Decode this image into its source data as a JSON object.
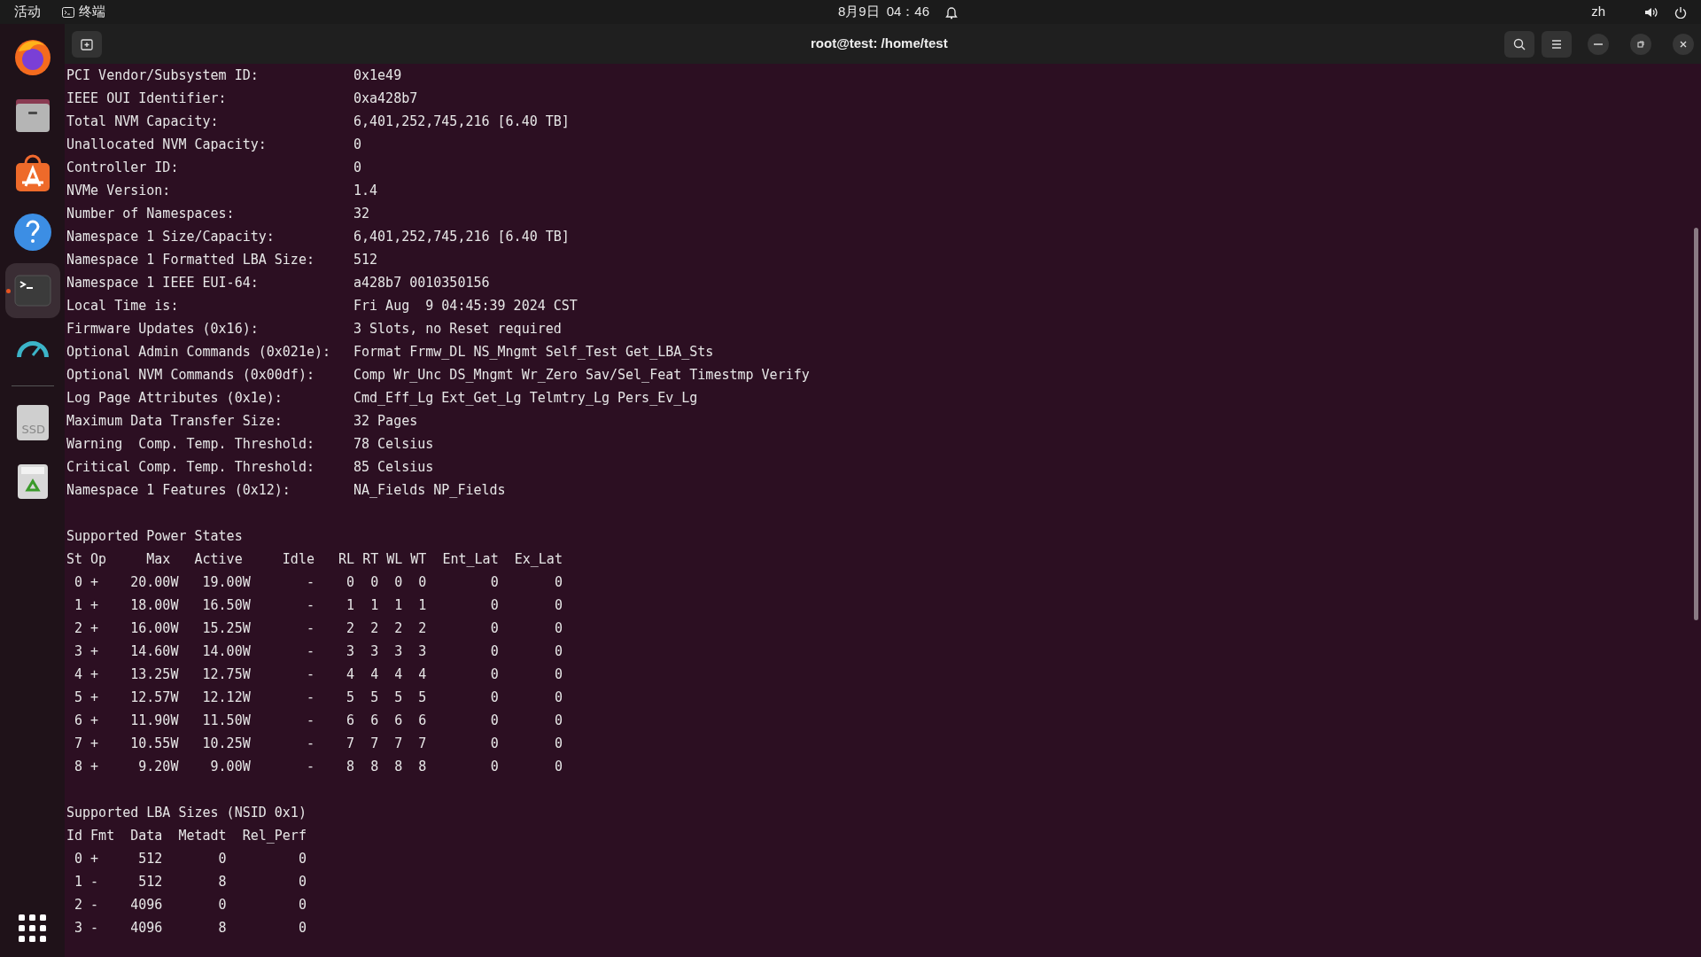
{
  "top_bar": {
    "activities": "活动",
    "app_name": "终端",
    "date": "8月9日",
    "time": "04：46",
    "language": "zh"
  },
  "dock": {
    "items": [
      {
        "kind": "firefox",
        "active": false
      },
      {
        "kind": "files",
        "active": false
      },
      {
        "kind": "store",
        "active": false
      },
      {
        "kind": "help",
        "active": false
      },
      {
        "kind": "terminal",
        "active": true
      },
      {
        "kind": "gauge",
        "active": false
      },
      {
        "kind": "separator"
      },
      {
        "kind": "ssd",
        "active": false,
        "label": "SSD"
      },
      {
        "kind": "trash",
        "active": false
      }
    ]
  },
  "window": {
    "title": "root@test: /home/test"
  },
  "terminal": {
    "fields": [
      {
        "label": "PCI Vendor/Subsystem ID:",
        "value": "0x1e49"
      },
      {
        "label": "IEEE OUI Identifier:",
        "value": "0xa428b7"
      },
      {
        "label": "Total NVM Capacity:",
        "value": "6,401,252,745,216 [6.40 TB]"
      },
      {
        "label": "Unallocated NVM Capacity:",
        "value": "0"
      },
      {
        "label": "Controller ID:",
        "value": "0"
      },
      {
        "label": "NVMe Version:",
        "value": "1.4"
      },
      {
        "label": "Number of Namespaces:",
        "value": "32"
      },
      {
        "label": "Namespace 1 Size/Capacity:",
        "value": "6,401,252,745,216 [6.40 TB]"
      },
      {
        "label": "Namespace 1 Formatted LBA Size:",
        "value": "512"
      },
      {
        "label": "Namespace 1 IEEE EUI-64:",
        "value": "a428b7 0010350156"
      },
      {
        "label": "Local Time is:",
        "value": "Fri Aug  9 04:45:39 2024 CST"
      },
      {
        "label": "Firmware Updates (0x16):",
        "value": "3 Slots, no Reset required"
      },
      {
        "label": "Optional Admin Commands (0x021e):",
        "value": "Format Frmw_DL NS_Mngmt Self_Test Get_LBA_Sts"
      },
      {
        "label": "Optional NVM Commands (0x00df):",
        "value": "Comp Wr_Unc DS_Mngmt Wr_Zero Sav/Sel_Feat Timestmp Verify"
      },
      {
        "label": "Log Page Attributes (0x1e):",
        "value": "Cmd_Eff_Lg Ext_Get_Lg Telmtry_Lg Pers_Ev_Lg"
      },
      {
        "label": "Maximum Data Transfer Size:",
        "value": "32 Pages"
      },
      {
        "label": "Warning  Comp. Temp. Threshold:",
        "value": "78 Celsius"
      },
      {
        "label": "Critical Comp. Temp. Threshold:",
        "value": "85 Celsius"
      },
      {
        "label": "Namespace 1 Features (0x12):",
        "value": "NA_Fields NP_Fields"
      }
    ],
    "tables": [
      {
        "title": "Supported Power States",
        "header": "St Op     Max   Active     Idle   RL RT WL WT  Ent_Lat  Ex_Lat",
        "rows": [
          " 0 +    20.00W   19.00W       -    0  0  0  0        0       0",
          " 1 +    18.00W   16.50W       -    1  1  1  1        0       0",
          " 2 +    16.00W   15.25W       -    2  2  2  2        0       0",
          " 3 +    14.60W   14.00W       -    3  3  3  3        0       0",
          " 4 +    13.25W   12.75W       -    4  4  4  4        0       0",
          " 5 +    12.57W   12.12W       -    5  5  5  5        0       0",
          " 6 +    11.90W   11.50W       -    6  6  6  6        0       0",
          " 7 +    10.55W   10.25W       -    7  7  7  7        0       0",
          " 8 +     9.20W    9.00W       -    8  8  8  8        0       0"
        ]
      },
      {
        "title": "Supported LBA Sizes (NSID 0x1)",
        "header": "Id Fmt  Data  Metadt  Rel_Perf",
        "rows": [
          " 0 +     512       0         0",
          " 1 -     512       8         0",
          " 2 -    4096       0         0",
          " 3 -    4096       8         0"
        ]
      }
    ]
  }
}
